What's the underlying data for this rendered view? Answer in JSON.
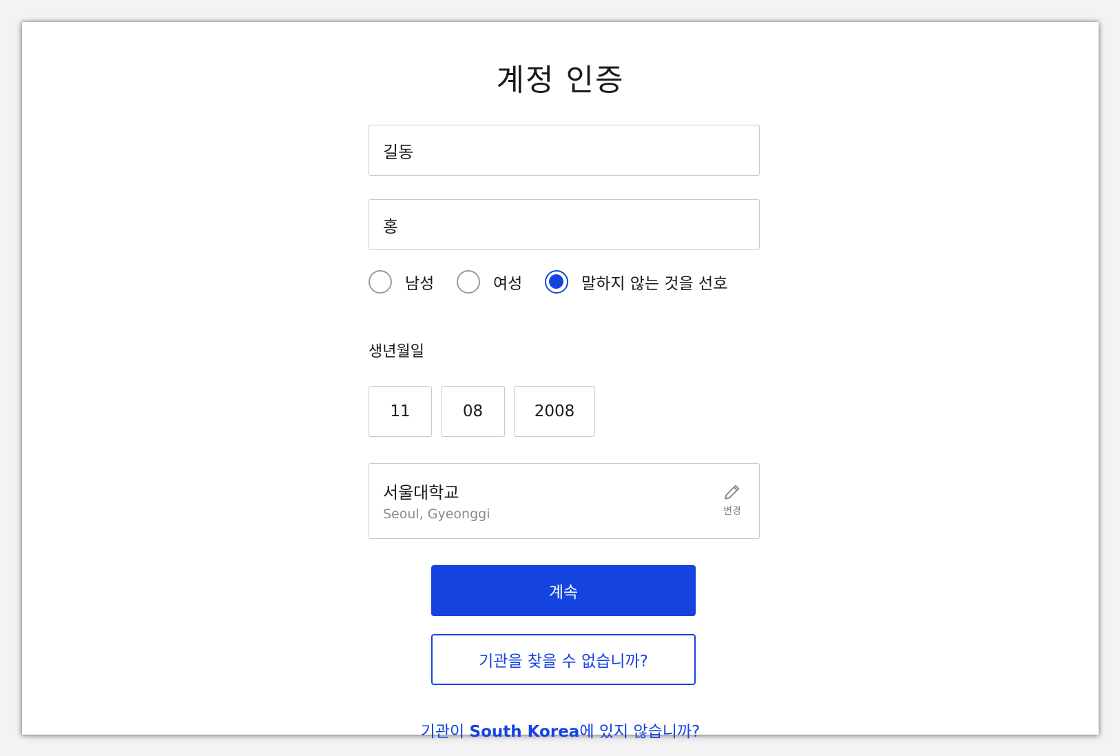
{
  "page": {
    "title": "계정 인증"
  },
  "form": {
    "first_name": {
      "value": "길동"
    },
    "last_name": {
      "value": "홍"
    },
    "gender": {
      "options": [
        {
          "label": "남성",
          "selected": false
        },
        {
          "label": "여성",
          "selected": false
        },
        {
          "label": "말하지 않는 것을 선호",
          "selected": true
        }
      ]
    },
    "dob": {
      "label": "생년월일",
      "day": "11",
      "month": "08",
      "year": "2008"
    },
    "institution": {
      "name": "서울대학교",
      "location": "Seoul, Gyeonggi",
      "edit_label": "변경",
      "edit_icon": "pencil-icon"
    }
  },
  "actions": {
    "continue_label": "계속",
    "cant_find_label": "기관을 찾을 수 없습니까?",
    "not_in_country_prefix": "기관이 ",
    "not_in_country_country": "South Korea",
    "not_in_country_suffix": "에 있지 않습니까?"
  },
  "colors": {
    "accent": "#1443e0",
    "border": "#c9c9c9",
    "muted_text": "#8a8a8a"
  }
}
